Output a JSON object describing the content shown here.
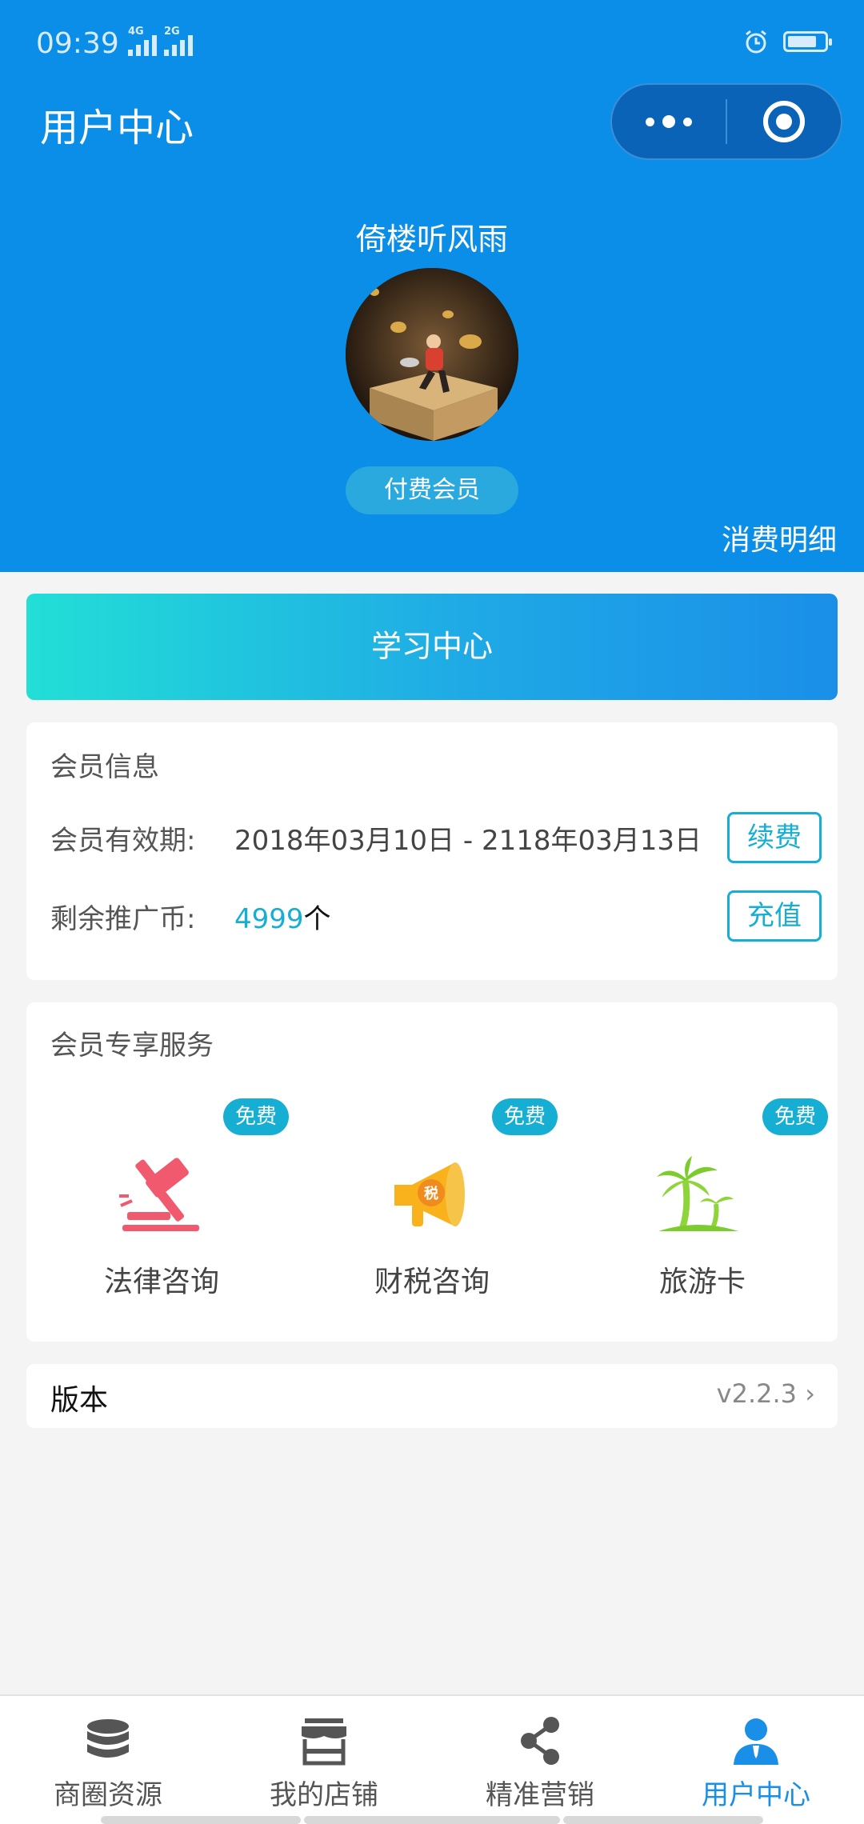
{
  "status_bar": {
    "time": "09:39",
    "network_1": "4G",
    "network_2": "2G"
  },
  "header": {
    "title": "用户中心",
    "more_icon": "more-dots-icon",
    "close_icon": "target-circle-icon"
  },
  "profile": {
    "username": "倚楼听风雨",
    "member_type": "付费会员",
    "spend_details_label": "消费明细"
  },
  "study_center_label": "学习中心",
  "member_info": {
    "title": "会员信息",
    "validity_label": "会员有效期:",
    "validity_value": "2018年03月10日 - 2118年03月13日",
    "renew_label": "续费",
    "coins_label": "剩余推广币:",
    "coins_value": "4999",
    "coins_unit": "个",
    "recharge_label": "充值"
  },
  "services": {
    "title": "会员专享服务",
    "items": [
      {
        "badge": "免费",
        "label": "法律咨询",
        "icon": "gavel-icon"
      },
      {
        "badge": "免费",
        "label": "财税咨询",
        "icon": "megaphone-tax-icon",
        "icon_text": "税"
      },
      {
        "badge": "免费",
        "label": "旅游卡",
        "icon": "palm-tree-icon"
      }
    ]
  },
  "version": {
    "label": "版本",
    "value": "v2.2.3"
  },
  "tabbar": {
    "items": [
      {
        "label": "商圈资源",
        "icon": "database-icon",
        "active": false
      },
      {
        "label": "我的店铺",
        "icon": "store-icon",
        "active": false
      },
      {
        "label": "精准营销",
        "icon": "share-icon",
        "active": false
      },
      {
        "label": "用户中心",
        "icon": "user-icon",
        "active": true
      }
    ]
  },
  "colors": {
    "header_blue": "#0a8ee8",
    "accent_teal": "#16aed3",
    "active_tab": "#1a8fe8"
  }
}
